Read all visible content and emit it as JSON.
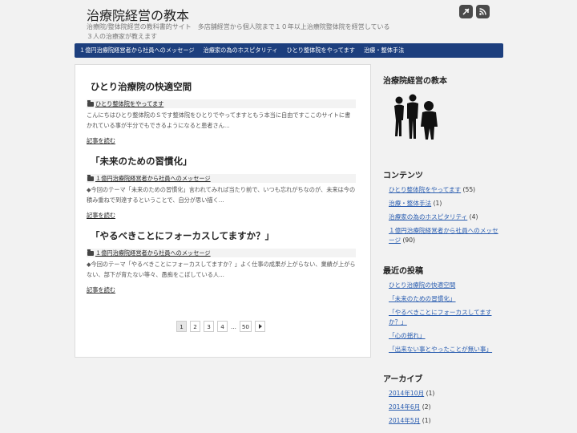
{
  "header": {
    "title": "治療院経営の教本",
    "description": "治療院/整体院経営の教科書的サイト　多店舗経営から個人院まで１０年以上治療院整体院を経営している３人の治療家が教えます",
    "icons": [
      "facebook-icon",
      "rss-icon"
    ]
  },
  "nav": {
    "items": [
      {
        "label": "１億円治療院経営者から社員へのメッセージ"
      },
      {
        "label": "治療家の為のホスピタリティ"
      },
      {
        "label": "ひとり整体院をやってます"
      },
      {
        "label": "治療・整体手法"
      }
    ]
  },
  "posts": [
    {
      "title": "ひとり治療院の快適空間",
      "category": "ひとり整体院をやってます",
      "excerpt": "こんにちはひとり整体院のＳです整体院をひとりでやってますともう本当に自由ですここのサイトに書かれている事が半分でもできるようになると患者さん...",
      "more": "記事を読む"
    },
    {
      "title": "「未来のための習慣化」",
      "category": "１億円治療院経営者から社員へのメッセージ",
      "excerpt": "◆今回のテーマ「未来のための習慣化」言われてみれば当たり前で、いつも忘れがちなのが、未来は今の積み重ねで到達するということで、自分が思い描く...",
      "more": "記事を読む"
    },
    {
      "title": "「やるべきことにフォーカスしてますか？」",
      "category": "１億円治療院経営者から社員へのメッセージ",
      "excerpt": "◆今回のテーマ「やるべきことにフォーカスしてますか？」よく仕事の成果が上がらない、業績が上がらない、部下が育たない等々、愚痴をこぼしている人...",
      "more": "記事を読む"
    }
  ],
  "pagination": {
    "pages": [
      "1",
      "2",
      "3",
      "4"
    ],
    "ellipsis": "...",
    "last": "50",
    "current": "1"
  },
  "sidebar": {
    "profile_title": "治療院経営の教本",
    "contents_title": "コンテンツ",
    "contents": [
      {
        "label": "ひとり整体院をやってます",
        "count": " (55)"
      },
      {
        "label": "治療・整体手法",
        "count": " (1)"
      },
      {
        "label": "治療家の為のホスピタリティ",
        "count": " (4)"
      },
      {
        "label": "１億円治療院経営者から社員へのメッセージ",
        "count": " (90)"
      }
    ],
    "recent_title": "最近の投稿",
    "recent": [
      {
        "label": "ひとり治療院の快適空間"
      },
      {
        "label": "「未来のための習慣化」"
      },
      {
        "label": "「やるべきことにフォーカスしてますか？」"
      },
      {
        "label": "「心の揺れ」"
      },
      {
        "label": "「出来ない事とやったことが無い事」"
      }
    ],
    "archive_title": "アーカイブ",
    "archives": [
      {
        "label": "2014年10月",
        "count": " (1)"
      },
      {
        "label": "2014年6月",
        "count": " (2)"
      },
      {
        "label": "2014年5月",
        "count": " (1)"
      }
    ]
  }
}
